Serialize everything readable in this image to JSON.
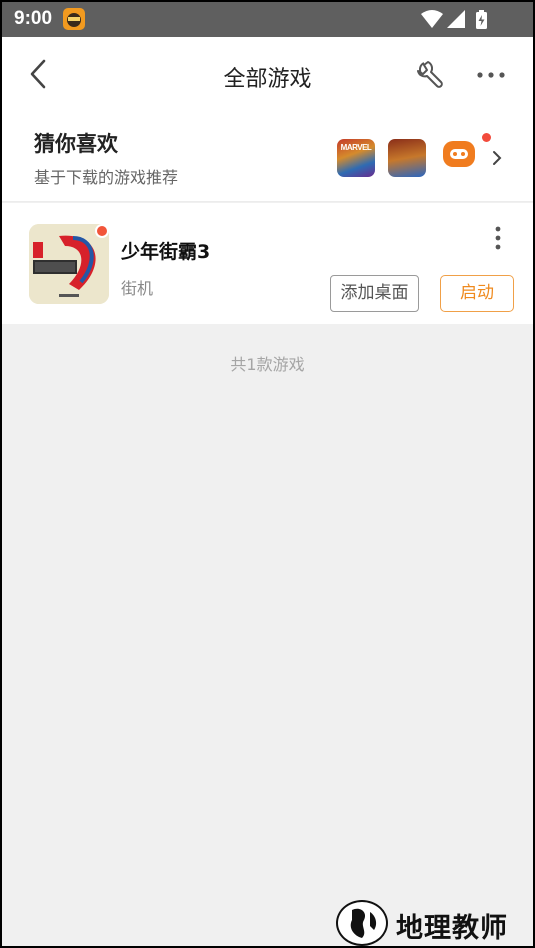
{
  "status_bar": {
    "time": "9:00",
    "icons": [
      "app-notification-icon",
      "wifi-icon",
      "signal-icon",
      "battery-charging-icon"
    ]
  },
  "header": {
    "title": "全部游戏",
    "back_icon": "chevron-left-icon",
    "tool_icon": "wrench-icon",
    "more_icon": "more-horizontal-icon"
  },
  "recommend": {
    "title": "猜你喜欢",
    "subtitle": "基于下载的游戏推荐",
    "thumbs": [
      {
        "label": "MARVEL"
      },
      {
        "label": ""
      },
      {
        "label": ""
      }
    ]
  },
  "games": [
    {
      "name": "少年街霸3",
      "category": "街机",
      "add_label": "添加桌面",
      "launch_label": "启动"
    }
  ],
  "footer": {
    "count_text": "共1款游戏"
  },
  "watermark": {
    "text": "地理教师"
  },
  "colors": {
    "accent": "#ef8a1e",
    "status_bar": "#5f5f5f",
    "badge": "#f24b3c"
  }
}
